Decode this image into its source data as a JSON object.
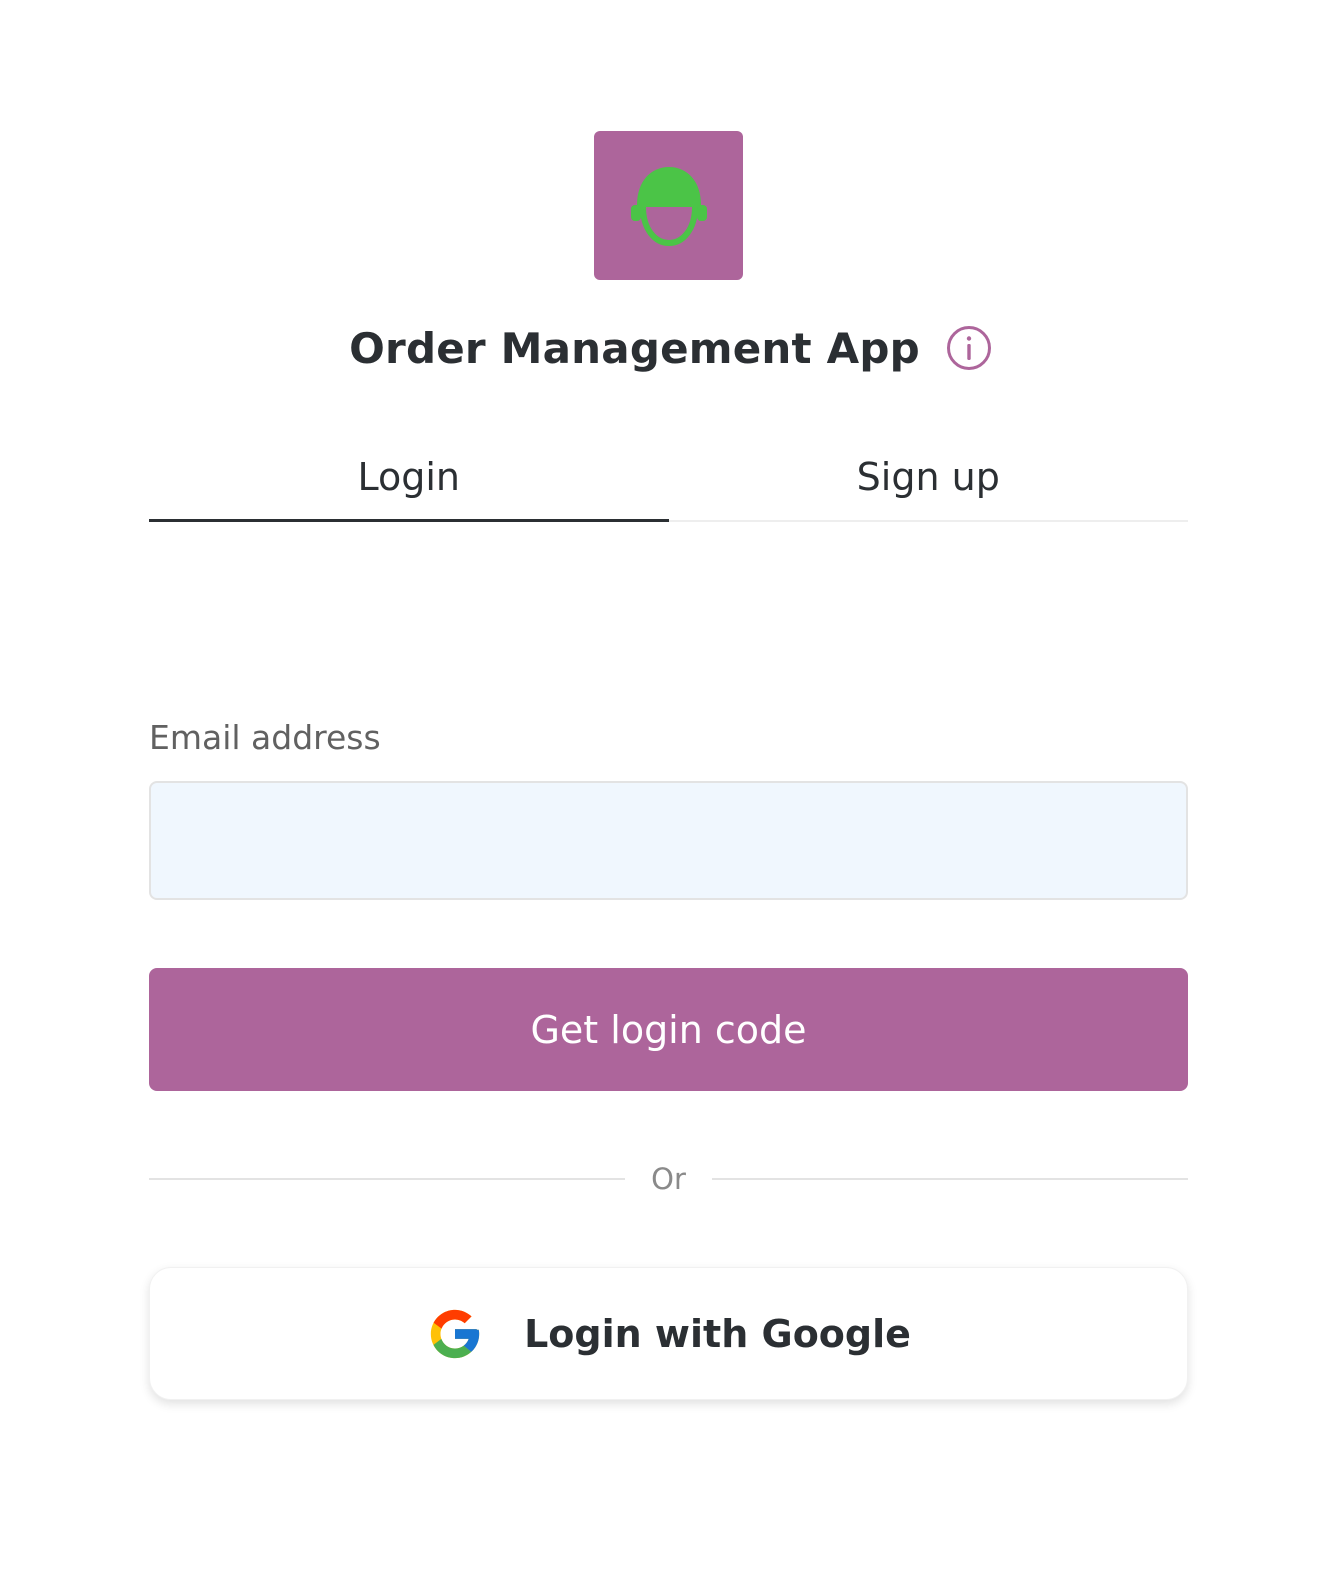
{
  "app": {
    "title": "Order Management App",
    "logo_icon": "helmet-person-icon",
    "info_icon": "info-icon"
  },
  "colors": {
    "brand": "#ad659b",
    "logo_figure": "#4bc447",
    "text_primary": "#2b2f33",
    "input_bg": "#f0f7fe"
  },
  "tabs": [
    {
      "label": "Login",
      "active": true
    },
    {
      "label": "Sign up",
      "active": false
    }
  ],
  "form": {
    "email_label": "Email address",
    "email_value": "",
    "email_placeholder": "",
    "submit_label": "Get login code"
  },
  "divider": {
    "text": "Or"
  },
  "google": {
    "label": "Login with Google",
    "icon": "google-g-icon"
  }
}
